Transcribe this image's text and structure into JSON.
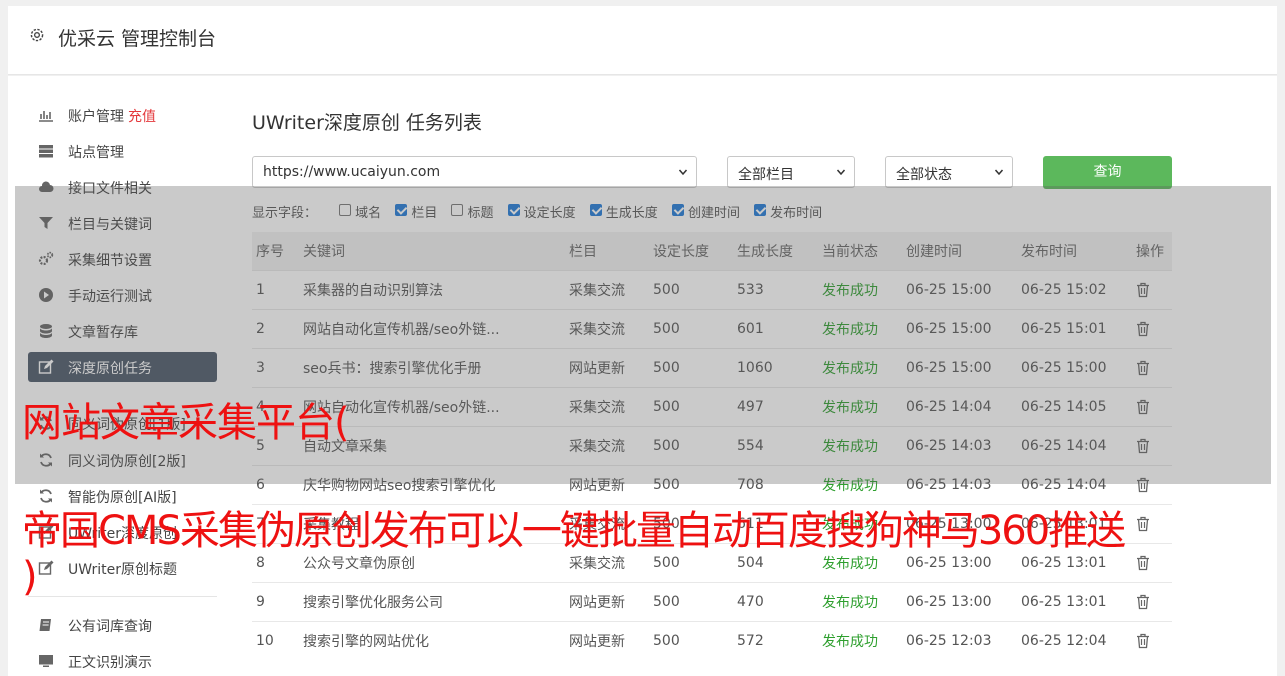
{
  "header": {
    "title": "优采云 管理控制台",
    "icon": "gear-icon"
  },
  "sidebar": {
    "items": [
      {
        "label": "账户管理",
        "badge": "充值",
        "icon": "bar-chart-icon"
      },
      {
        "label": "站点管理",
        "icon": "server-icon"
      },
      {
        "label": "接口文件相关",
        "icon": "cloud-upload-icon"
      },
      {
        "label": "栏目与关键词",
        "icon": "filter-icon"
      },
      {
        "label": "采集细节设置",
        "icon": "gears-icon"
      },
      {
        "label": "手动运行测试",
        "icon": "play-circle-icon"
      },
      {
        "label": "文章暂存库",
        "icon": "database-icon"
      },
      {
        "label": "深度原创任务",
        "icon": "edit-icon",
        "active": true
      },
      {
        "label": "同义词伪原创[1版]",
        "icon": "refresh-icon"
      },
      {
        "label": "同义词伪原创[2版]",
        "icon": "refresh-icon"
      },
      {
        "label": "智能伪原创[AI版]",
        "icon": "refresh-icon"
      },
      {
        "label": "UWriter深度原创",
        "icon": "edit-icon"
      },
      {
        "label": "UWriter原创标题",
        "icon": "edit-icon"
      },
      {
        "label": "公有词库查询",
        "icon": "book-icon"
      },
      {
        "label": "正文识别演示",
        "icon": "monitor-icon"
      }
    ]
  },
  "main": {
    "title": "UWriter深度原创 任务列表",
    "filters": {
      "site": "https://www.ucaiyun.com",
      "column": "全部栏目",
      "status": "全部状态",
      "query_label": "查询"
    },
    "fields_label": "显示字段：",
    "fields": [
      {
        "label": "域名",
        "checked": false
      },
      {
        "label": "栏目",
        "checked": true
      },
      {
        "label": "标题",
        "checked": false
      },
      {
        "label": "设定长度",
        "checked": true
      },
      {
        "label": "生成长度",
        "checked": true
      },
      {
        "label": "创建时间",
        "checked": true
      },
      {
        "label": "发布时间",
        "checked": true
      }
    ],
    "table": {
      "headers": [
        "序号",
        "关键词",
        "栏目",
        "设定长度",
        "生成长度",
        "当前状态",
        "创建时间",
        "发布时间",
        "操作"
      ],
      "rows": [
        [
          "1",
          "采集器的自动识别算法",
          "采集交流",
          "500",
          "533",
          "发布成功",
          "06-25 15:00",
          "06-25 15:02"
        ],
        [
          "2",
          "网站自动化宣传机器/seo外链...",
          "采集交流",
          "500",
          "601",
          "发布成功",
          "06-25 15:00",
          "06-25 15:01"
        ],
        [
          "3",
          "seo兵书：搜索引擎优化手册",
          "网站更新",
          "500",
          "1060",
          "发布成功",
          "06-25 15:00",
          "06-25 15:00"
        ],
        [
          "4",
          "网站自动化宣传机器/seo外链...",
          "采集交流",
          "500",
          "497",
          "发布成功",
          "06-25 14:04",
          "06-25 14:05"
        ],
        [
          "5",
          "自动文章采集",
          "采集交流",
          "500",
          "554",
          "发布成功",
          "06-25 14:03",
          "06-25 14:04"
        ],
        [
          "6",
          "庆华购物网站seo搜索引擎优化",
          "网站更新",
          "500",
          "708",
          "发布成功",
          "06-25 14:03",
          "06-25 14:04"
        ],
        [
          "7",
          "采集教程",
          "采集交流",
          "500",
          "611",
          "发布成功",
          "06-25 13:00",
          "06-25 13:01"
        ],
        [
          "8",
          "公众号文章伪原创",
          "采集交流",
          "500",
          "504",
          "发布成功",
          "06-25 13:00",
          "06-25 13:01"
        ],
        [
          "9",
          "搜索引擎优化服务公司",
          "网站更新",
          "500",
          "470",
          "发布成功",
          "06-25 13:00",
          "06-25 13:01"
        ],
        [
          "10",
          "搜索引擎的网站优化",
          "网站更新",
          "500",
          "572",
          "发布成功",
          "06-25 12:03",
          "06-25 12:04"
        ]
      ]
    }
  },
  "watermark": {
    "line1": "网站文章采集平台(",
    "line2": "帝国CMS采集伪原创发布可以一键批量自动百度搜狗神马360推送",
    "line3": ")"
  },
  "colors": {
    "accent": "#5cb85c",
    "active_nav": "#4a5768",
    "success": "#2e9f2e",
    "watermark": "#ee1111"
  }
}
